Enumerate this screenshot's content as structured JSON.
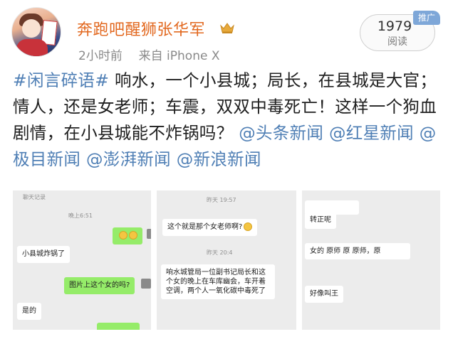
{
  "header": {
    "username": "奔跑吧醒狮张华军",
    "time": "2小时前",
    "source_prefix": "来自",
    "source_device": "iPhone X",
    "read_count": "1979",
    "read_label": "阅读",
    "promo_badge": "推广"
  },
  "post": {
    "topic": "#闲言碎语#",
    "text": " 响水，一个小县城；局长，在县城是大官；情人，还是女老师；车震，双双中毒死亡！这样一个狗血剧情，在小县城能不炸锅吗？",
    "mentions": [
      "@头条新闻",
      "@红星新闻",
      "@极目新闻",
      "@澎湃新闻",
      "@新浪新闻"
    ]
  },
  "thumbnails": {
    "shot1": {
      "header": "聊天记录",
      "time": "晚上6:51",
      "msg_exploded": "小县城炸锅了",
      "msg_question": "图片上这个女的吗?",
      "msg_yes": "是的"
    },
    "shot2": {
      "time1": "昨天 19:57",
      "msg_teacher": "这个就是那个女老师啊?",
      "time2": "昨天 20:4",
      "msg_news": "响水城管局一位副书记局长和这个女的晚上在车库幽会，车开着空调，两个人一氧化碳中毒死了"
    },
    "shot3": {
      "msg_transfer": "转正呢",
      "msg_teacher_role": "女的 原师 原 原师，原",
      "msg_name": "好像叫王"
    }
  },
  "colors": {
    "username": "#e2681f",
    "link": "#4f7fb5",
    "chat_green": "#95ec69",
    "badge": "#7ea7d8"
  },
  "icons": [
    "crown-icon",
    "avatar"
  ]
}
